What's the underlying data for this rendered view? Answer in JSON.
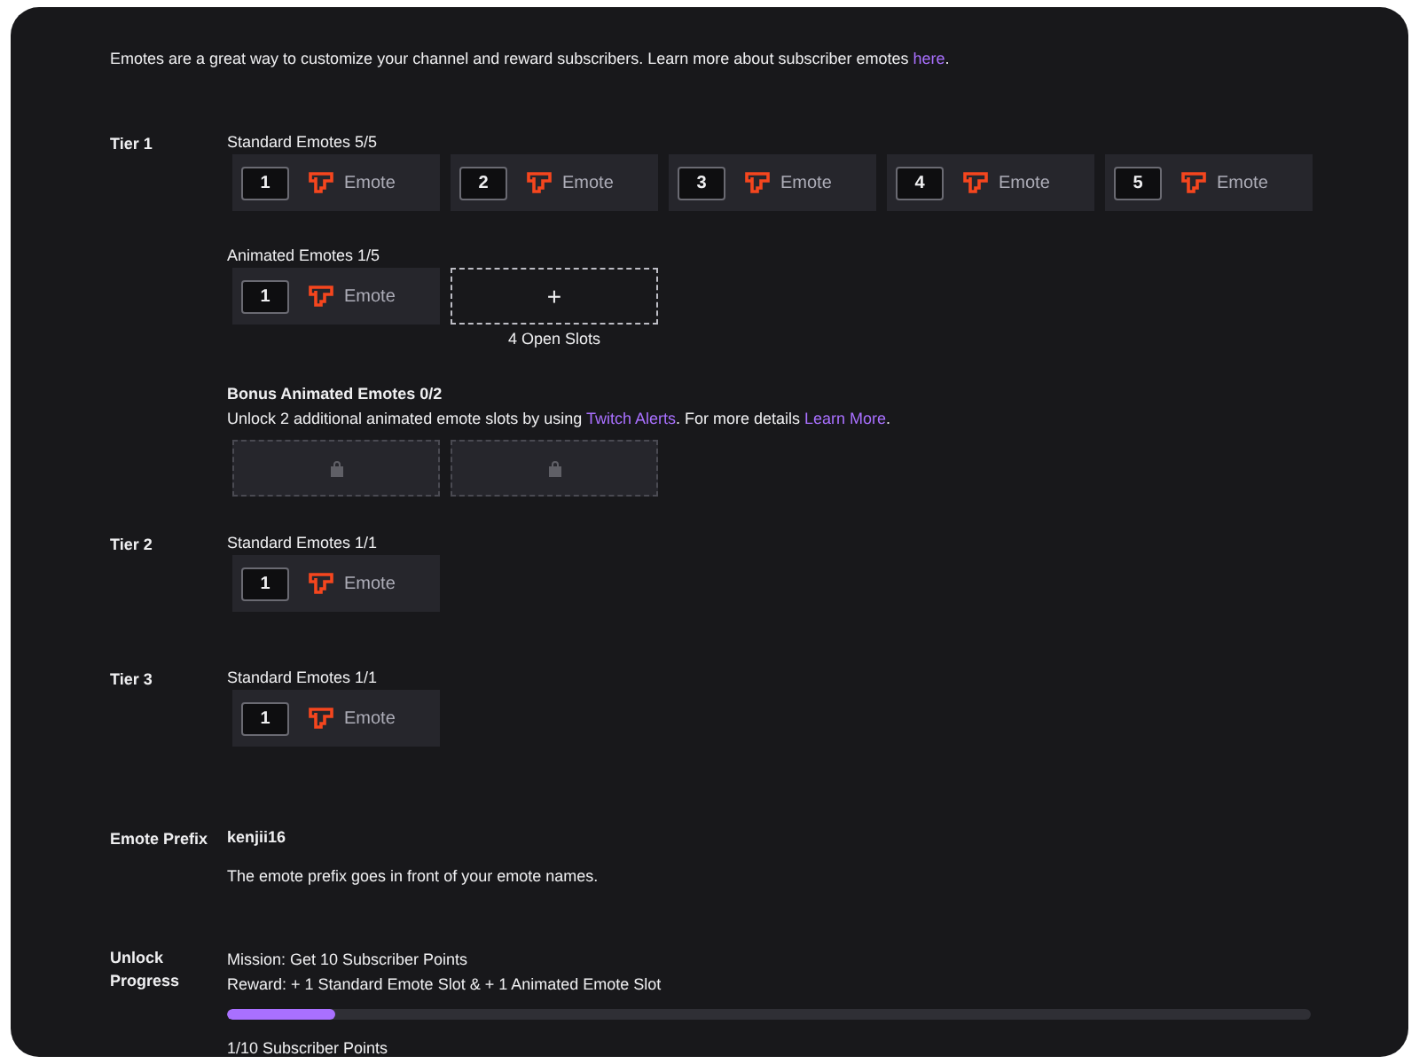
{
  "intro": {
    "text": "Emotes are a great way to customize your channel and reward subscribers. Learn more about subscriber emotes ",
    "link": "here",
    "after": "."
  },
  "tiers": [
    {
      "label": "Tier 1",
      "groups": [
        {
          "title": "Standard Emotes 5/5",
          "slots": [
            {
              "kind": "emote",
              "number": "1",
              "label": "Emote"
            },
            {
              "kind": "emote",
              "number": "2",
              "label": "Emote"
            },
            {
              "kind": "emote",
              "number": "3",
              "label": "Emote"
            },
            {
              "kind": "emote",
              "number": "4",
              "label": "Emote"
            },
            {
              "kind": "emote",
              "number": "5",
              "label": "Emote"
            }
          ]
        },
        {
          "title": "Animated Emotes 1/5",
          "slots": [
            {
              "kind": "emote",
              "number": "1",
              "label": "Emote"
            },
            {
              "kind": "add",
              "symbol": "+",
              "caption": "4 Open Slots"
            }
          ]
        },
        {
          "title": "Bonus Animated Emotes 0/2",
          "description": [
            {
              "kind": "text",
              "text": "Unlock 2 additional animated emote slots by using "
            },
            {
              "kind": "link",
              "text": "Twitch Alerts"
            },
            {
              "kind": "text",
              "text": ". For more details "
            },
            {
              "kind": "link",
              "text": "Learn More"
            },
            {
              "kind": "text",
              "text": "."
            }
          ],
          "slots": [
            {
              "kind": "locked"
            },
            {
              "kind": "locked"
            }
          ]
        }
      ]
    },
    {
      "label": "Tier 2",
      "groups": [
        {
          "title": "Standard Emotes 1/1",
          "slots": [
            {
              "kind": "emote",
              "number": "1",
              "label": "Emote"
            }
          ]
        }
      ]
    },
    {
      "label": "Tier 3",
      "groups": [
        {
          "title": "Standard Emotes 1/1",
          "slots": [
            {
              "kind": "emote",
              "number": "1",
              "label": "Emote"
            }
          ]
        }
      ]
    }
  ],
  "prefix": {
    "label": "Emote Prefix",
    "value": "kenjii16",
    "hint": "The emote prefix goes in front of your emote names."
  },
  "progress": {
    "label": "Unlock Progress",
    "mission": "Mission: Get 10 Subscriber Points",
    "reward": "Reward: + 1 Standard Emote Slot & + 1 Animated Emote Slot",
    "level": 0.1,
    "reading": "1/10 Subscriber Points"
  }
}
